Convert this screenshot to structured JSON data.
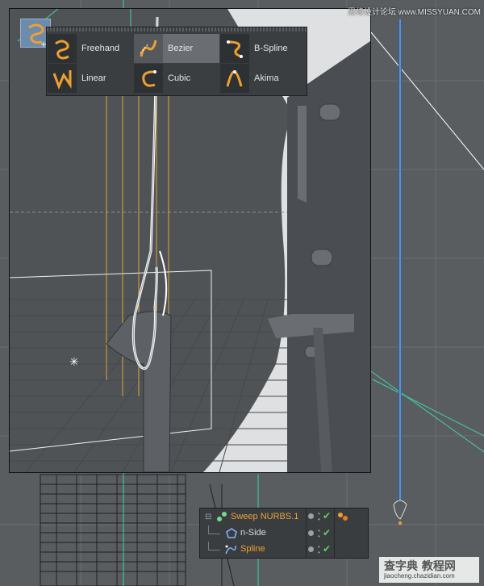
{
  "spline_menu": {
    "items": [
      {
        "label": "Freehand",
        "active": false,
        "icon": "freehand-spline-icon"
      },
      {
        "label": "Bezier",
        "active": true,
        "icon": "bezier-spline-icon"
      },
      {
        "label": "B-Spline",
        "active": false,
        "icon": "bspline-icon"
      },
      {
        "label": "Linear",
        "active": false,
        "icon": "linear-spline-icon"
      },
      {
        "label": "Cubic",
        "active": false,
        "icon": "cubic-spline-icon"
      },
      {
        "label": "Akima",
        "active": false,
        "icon": "akima-spline-icon"
      }
    ]
  },
  "object_manager": {
    "objects": [
      {
        "name": "Sweep NURBS.1",
        "color": "#e6a23c",
        "icon": "sweep-nurbs-icon"
      },
      {
        "name": "n-Side",
        "color": "#d8dadc",
        "icon": "nside-icon"
      },
      {
        "name": "Spline",
        "color": "#f0a030",
        "icon": "spline-object-icon"
      }
    ]
  },
  "watermark": {
    "top": "思缘设计论坛 www.MISSYUAN.COM",
    "logo": "查字典 教程网",
    "url": "jiaocheng.chazidian.com"
  },
  "colors": {
    "accent_orange": "#f0a030",
    "check_green": "#5fd05f",
    "viewport_bg": "#4f5356"
  }
}
